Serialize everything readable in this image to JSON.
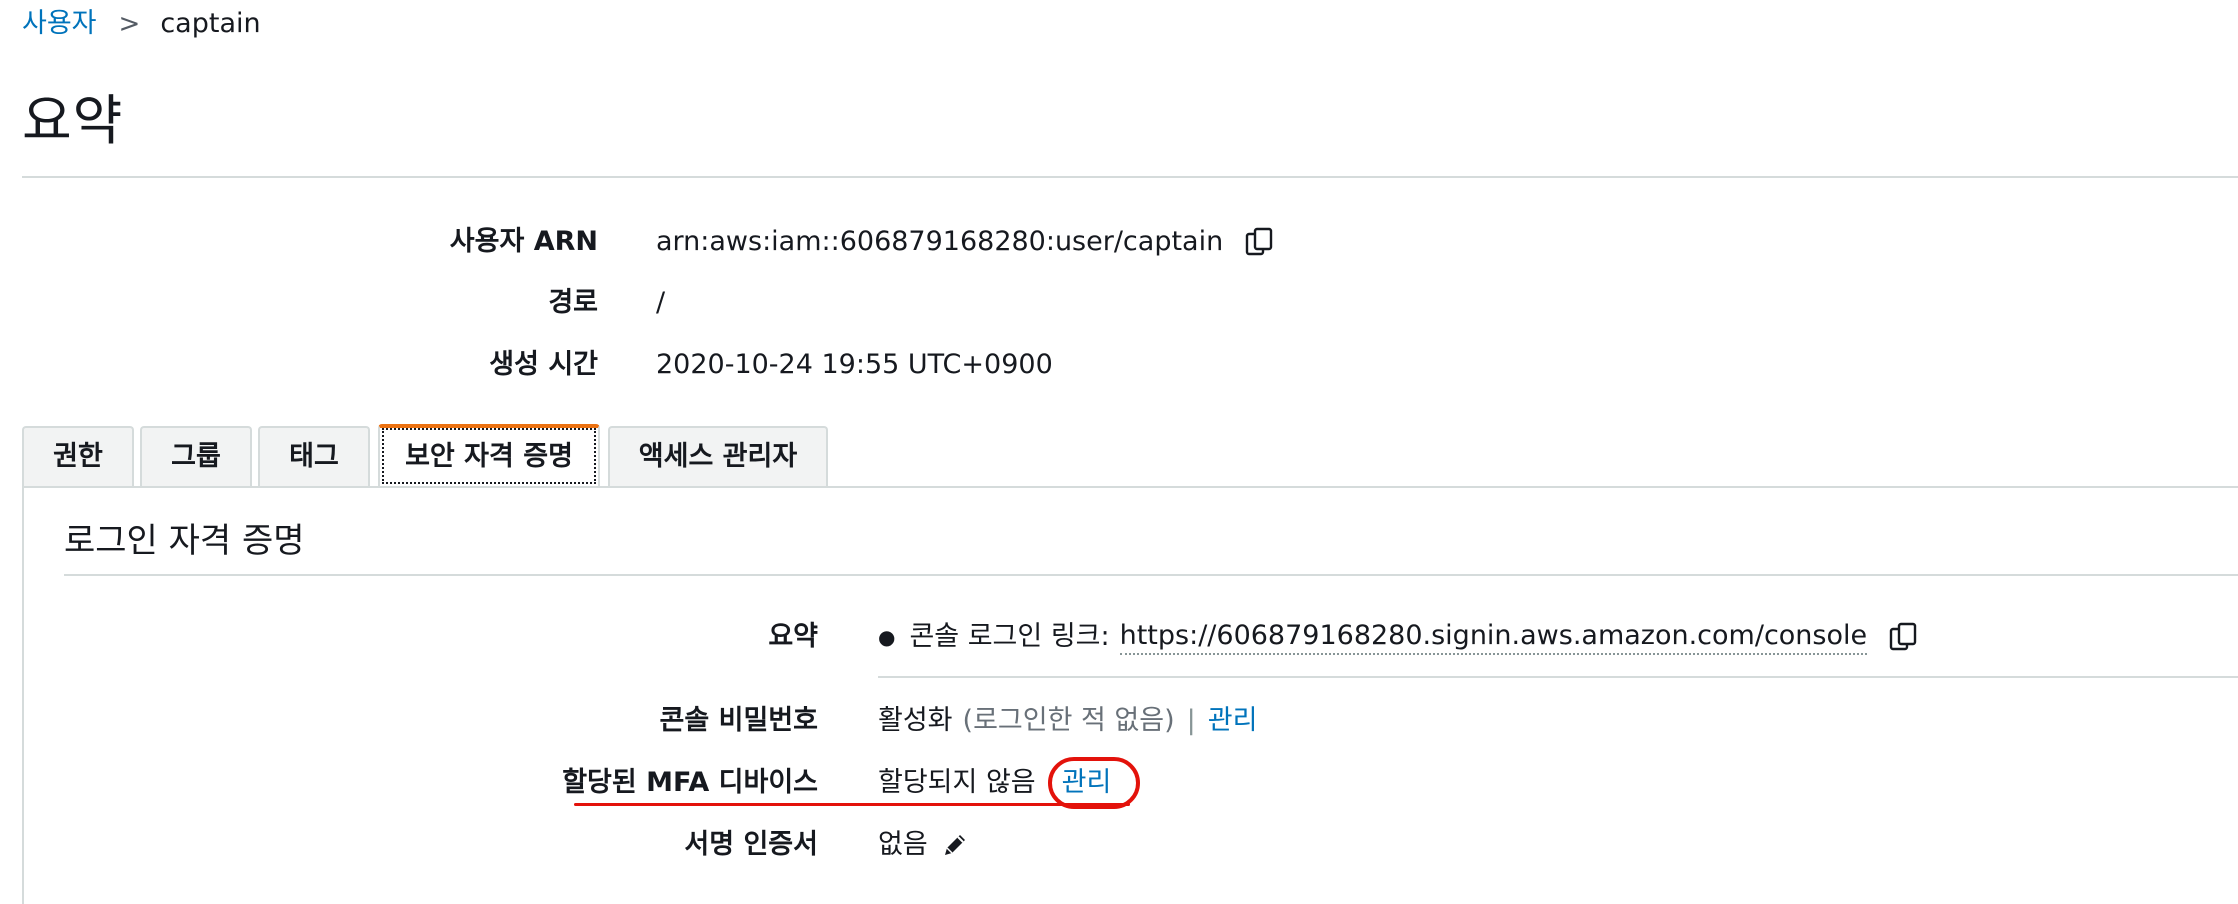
{
  "breadcrumb": {
    "parent": "사용자",
    "separator": ">",
    "current": "captain"
  },
  "page_title": "요약",
  "summary": {
    "arn": {
      "label": "사용자 ARN",
      "value": "arn:aws:iam::606879168280:user/captain",
      "icon": "copy-icon"
    },
    "path": {
      "label": "경로",
      "value": "/"
    },
    "created": {
      "label": "생성 시간",
      "value": "2020-10-24 19:55 UTC+0900"
    }
  },
  "tabs": [
    {
      "label": "권한",
      "active": false
    },
    {
      "label": "그룹",
      "active": false
    },
    {
      "label": "태그",
      "active": false
    },
    {
      "label": "보안 자격 증명",
      "active": true
    },
    {
      "label": "액세스 관리자",
      "active": false
    }
  ],
  "credentials": {
    "section_title": "로그인 자격 증명",
    "summary": {
      "label": "요약",
      "bullet": "●",
      "prefix": "콘솔 로그인 링크:",
      "url": "https://606879168280.signin.aws.amazon.com/console",
      "icon": "copy-icon"
    },
    "console_password": {
      "label": "콘솔 비밀번호",
      "status": "활성화",
      "note": "(로그인한 적 없음)",
      "separator": "|",
      "manage": "관리"
    },
    "mfa": {
      "label": "할당된 MFA 디바이스",
      "status": "할당되지 않음",
      "manage": "관리"
    },
    "signing_cert": {
      "label": "서명 인증서",
      "value": "없음",
      "icon": "pencil-icon"
    }
  },
  "colors": {
    "link": "#0073bb",
    "active_tab_accent": "#ec7211",
    "annotation": "#e3120b",
    "divider": "#d5dbdb"
  }
}
